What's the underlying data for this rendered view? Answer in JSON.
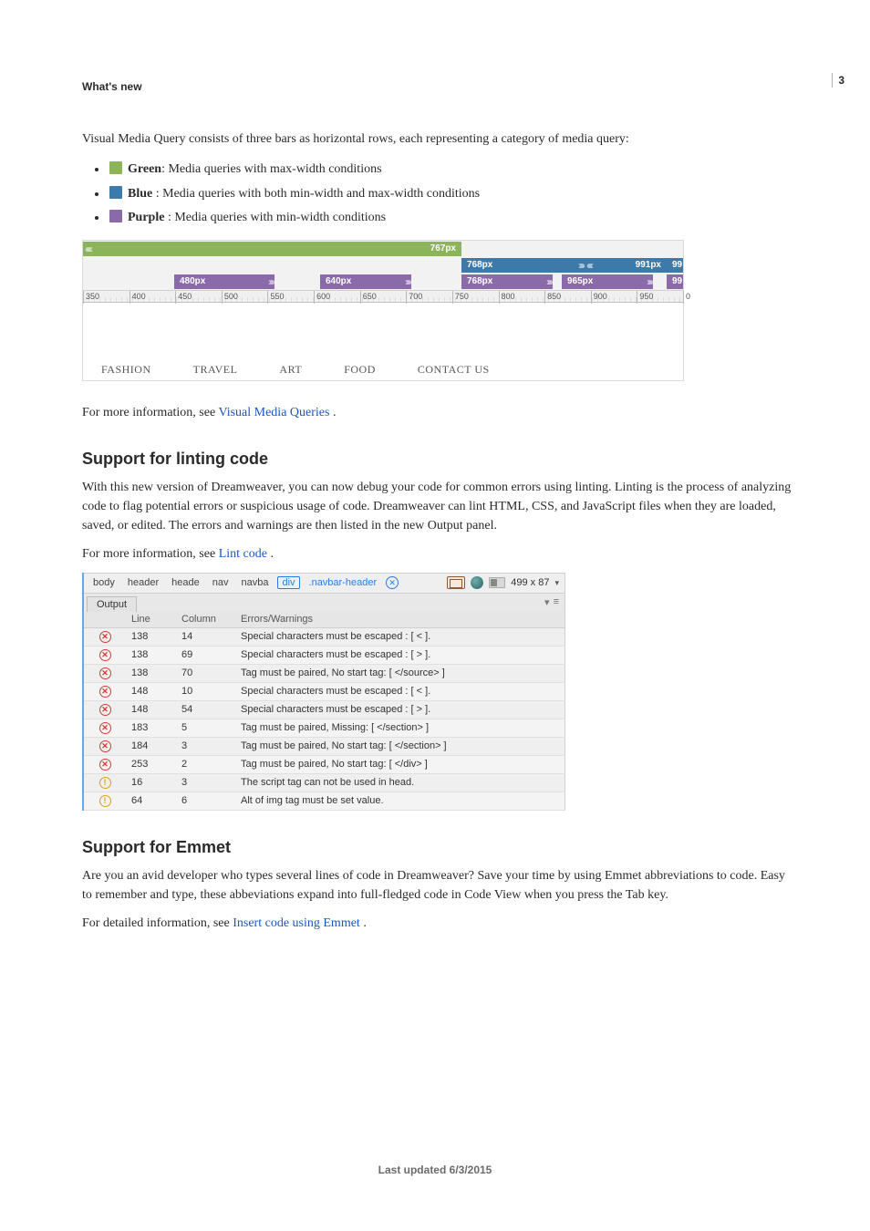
{
  "page_number": "3",
  "header_section": "What's new",
  "intro_p": "Visual Media Query consists of three bars as horizontal rows, each representing a category of media query:",
  "legend": [
    {
      "color": "#8cb45a",
      "name": "Green",
      "desc": ": Media queries with max-width conditions"
    },
    {
      "color": "#3e7aa9",
      "name": "Blue",
      "desc": " : Media queries with both min-width and max-width conditions"
    },
    {
      "color": "#8a6aa8",
      "name": "Purple",
      "desc": " : Media queries with min-width conditions"
    }
  ],
  "vmq": {
    "bars": {
      "green_end_label": "767px",
      "blue_a_label": "768px",
      "blue_b_label": "991px",
      "blue_c_label": "99",
      "purple_a_label": "480px",
      "purple_b_label": "640px",
      "purple_c_label": "768px",
      "purple_d_label": "965px",
      "purple_e_label": "99"
    },
    "ruler_ticks": [
      "350",
      "400",
      "450",
      "500",
      "550",
      "600",
      "650",
      "700",
      "750",
      "800",
      "850",
      "900",
      "950",
      "0"
    ],
    "menu": [
      "FASHION",
      "TRAVEL",
      "ART",
      "FOOD",
      "CONTACT US"
    ]
  },
  "after_vmq_prefix": "For more information, see ",
  "after_vmq_link": "Visual Media Queries",
  "after_vmq_suffix": " .",
  "lint": {
    "heading": "Support for linting code",
    "p1": "With this new version of Dreamweaver, you can now debug your code for common errors using linting. Linting is the process of analyzing code to flag potential errors or suspicious usage of code. Dreamweaver can lint HTML, CSS, and JavaScript files when they are loaded, saved, or edited. The errors and warnings are then listed in the new Output panel.",
    "more_prefix": "For more information, see ",
    "more_link": "Lint code",
    "more_suffix": " .",
    "breadcrumb": {
      "items": [
        "body",
        "header",
        "heade",
        "nav",
        "navba"
      ],
      "tag_item": "div",
      "selector": ".navbar-header",
      "dims": "499 x 87",
      "caret": "▾"
    },
    "tab_label": "Output",
    "columns": {
      "sev": "",
      "line": "Line",
      "col": "Column",
      "msg": "Errors/Warnings"
    },
    "rows": [
      {
        "sev": "err",
        "line": "138",
        "col": "14",
        "msg": "Special characters must be escaped : [ < ]."
      },
      {
        "sev": "err",
        "line": "138",
        "col": "69",
        "msg": "Special characters must be escaped : [ > ]."
      },
      {
        "sev": "err",
        "line": "138",
        "col": "70",
        "msg": "Tag must be paired, No start tag: [ </source> ]"
      },
      {
        "sev": "err",
        "line": "148",
        "col": "10",
        "msg": "Special characters must be escaped : [ < ]."
      },
      {
        "sev": "err",
        "line": "148",
        "col": "54",
        "msg": "Special characters must be escaped : [ > ]."
      },
      {
        "sev": "err",
        "line": "183",
        "col": "5",
        "msg": "Tag must be paired, Missing: [ </section> ]"
      },
      {
        "sev": "err",
        "line": "184",
        "col": "3",
        "msg": "Tag must be paired, No start tag: [ </section> ]"
      },
      {
        "sev": "err",
        "line": "253",
        "col": "2",
        "msg": "Tag must be paired, No start tag: [ </div> ]"
      },
      {
        "sev": "wrn",
        "line": "16",
        "col": "3",
        "msg": "The script tag can not be used in head."
      },
      {
        "sev": "wrn",
        "line": "64",
        "col": "6",
        "msg": "Alt of img tag must be set value."
      }
    ]
  },
  "emmet": {
    "heading": "Support for Emmet",
    "p1": "Are you an avid developer who types several lines of code in Dreamweaver? Save your time by using Emmet abbreviations to code. Easy to remember and type, these abbeviations expand into full-fledged code in Code View when you press the Tab key.",
    "more_prefix": "For detailed information, see ",
    "more_link": "Insert code using Emmet",
    "more_suffix": " ."
  },
  "footer": "Last updated 6/3/2015"
}
